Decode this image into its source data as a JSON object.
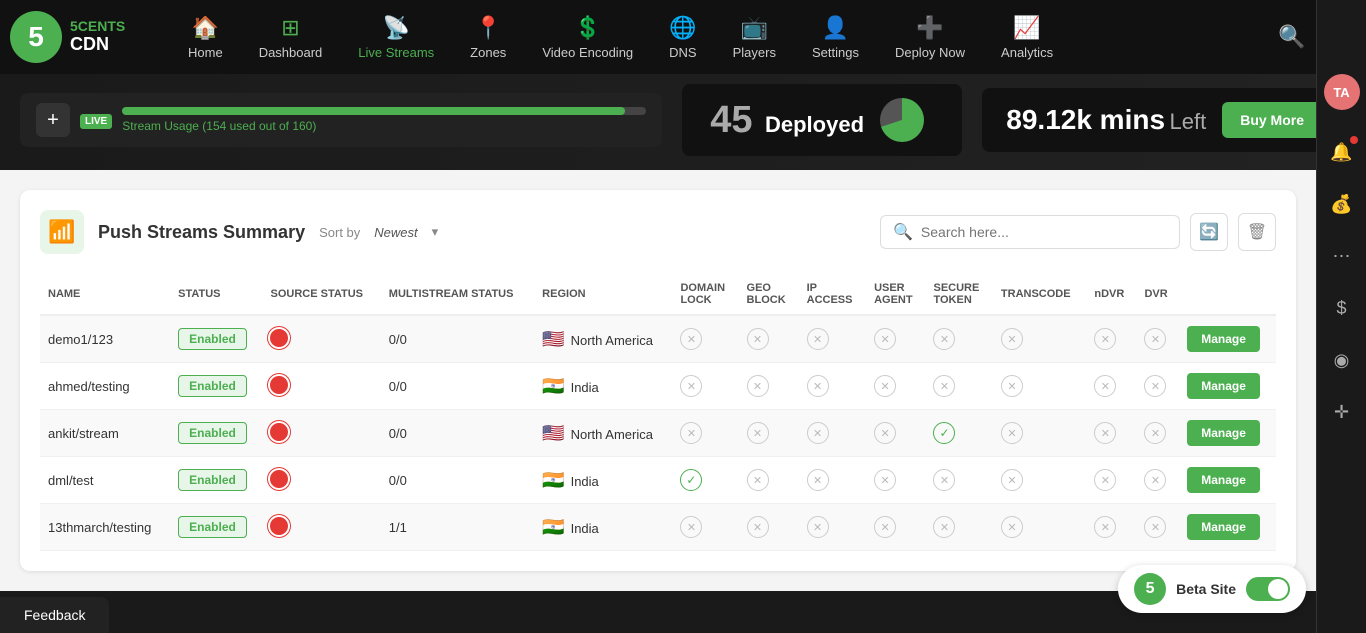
{
  "brand": {
    "logo_number": "5",
    "name_line1": "5CENTS",
    "name_line2": "CDN"
  },
  "nav": {
    "items": [
      {
        "id": "home",
        "label": "Home",
        "icon": "🏠"
      },
      {
        "id": "dashboard",
        "label": "Dashboard",
        "icon": "⊞"
      },
      {
        "id": "live-streams",
        "label": "Live Streams",
        "icon": "📡"
      },
      {
        "id": "zones",
        "label": "Zones",
        "icon": "📍"
      },
      {
        "id": "video-encoding",
        "label": "Video Encoding",
        "icon": "💲"
      },
      {
        "id": "dns",
        "label": "DNS",
        "icon": "🌐"
      },
      {
        "id": "players",
        "label": "Players",
        "icon": "📺"
      },
      {
        "id": "settings",
        "label": "Settings",
        "icon": "👤"
      },
      {
        "id": "deploy-now",
        "label": "Deploy Now",
        "icon": "➕"
      },
      {
        "id": "analytics",
        "label": "Analytics",
        "icon": "📈"
      }
    ]
  },
  "header": {
    "add_label": "+",
    "live_label": "LIVE",
    "usage_text": "Stream Usage (154 used out of 160)",
    "deployed_count": "45",
    "deployed_label": "Deployed",
    "mins_number": "89.12k mins",
    "mins_label": "Left",
    "buy_more_label": "Buy More"
  },
  "sidebar": {
    "avatar": "TA",
    "icons": [
      "🔔",
      "💰",
      "⋯",
      "$",
      "◉",
      "✛"
    ]
  },
  "card": {
    "title": "Push Streams Summary",
    "sort_label": "Sort by",
    "sort_value": "Newest",
    "search_placeholder": "Search here...",
    "columns": [
      "NAME",
      "STATUS",
      "SOURCE STATUS",
      "MULTISTREAM STATUS",
      "REGION",
      "DOMAIN LOCK",
      "GEO BLOCK",
      "IP ACCESS",
      "USER AGENT",
      "SECURE TOKEN",
      "TRANSCODE",
      "nDVR",
      "DVR",
      ""
    ],
    "rows": [
      {
        "name": "demo1/123",
        "status": "Enabled",
        "source": "red",
        "multistream": "0/0",
        "region_flag": "🇺🇸",
        "region": "North America",
        "domain_lock": "x",
        "geo_block": "x",
        "ip_access": "x",
        "user_agent": "x",
        "secure_token": "x",
        "transcode": "x",
        "ndvr": "x",
        "dvr": "x",
        "manage": "Manage"
      },
      {
        "name": "ahmed/testing",
        "status": "Enabled",
        "source": "red",
        "multistream": "0/0",
        "region_flag": "🇮🇳",
        "region": "India",
        "domain_lock": "x",
        "geo_block": "x",
        "ip_access": "x",
        "user_agent": "x",
        "secure_token": "x",
        "transcode": "x",
        "ndvr": "x",
        "dvr": "x",
        "manage": "Manage"
      },
      {
        "name": "ankit/stream",
        "status": "Enabled",
        "source": "red",
        "multistream": "0/0",
        "region_flag": "🇺🇸",
        "region": "North America",
        "domain_lock": "x",
        "geo_block": "x",
        "ip_access": "x",
        "user_agent": "x",
        "secure_token": "check",
        "transcode": "x",
        "ndvr": "x",
        "dvr": "x",
        "manage": "Manage"
      },
      {
        "name": "dml/test",
        "status": "Enabled",
        "source": "red",
        "multistream": "0/0",
        "region_flag": "🇮🇳",
        "region": "India",
        "domain_lock": "check",
        "geo_block": "x",
        "ip_access": "x",
        "user_agent": "x",
        "secure_token": "x",
        "transcode": "x",
        "ndvr": "x",
        "dvr": "x",
        "manage": "Manage"
      },
      {
        "name": "13thmarch/testing",
        "status": "Enabled",
        "source": "red",
        "multistream": "1/1",
        "region_flag": "🇮🇳",
        "region": "India",
        "domain_lock": "x",
        "geo_block": "x",
        "ip_access": "x",
        "user_agent": "x",
        "secure_token": "x",
        "transcode": "x",
        "ndvr": "x",
        "dvr": "x",
        "manage": "Manage"
      }
    ]
  },
  "feedback": {
    "label": "Feedback"
  },
  "beta_site": {
    "label": "Beta Site"
  }
}
